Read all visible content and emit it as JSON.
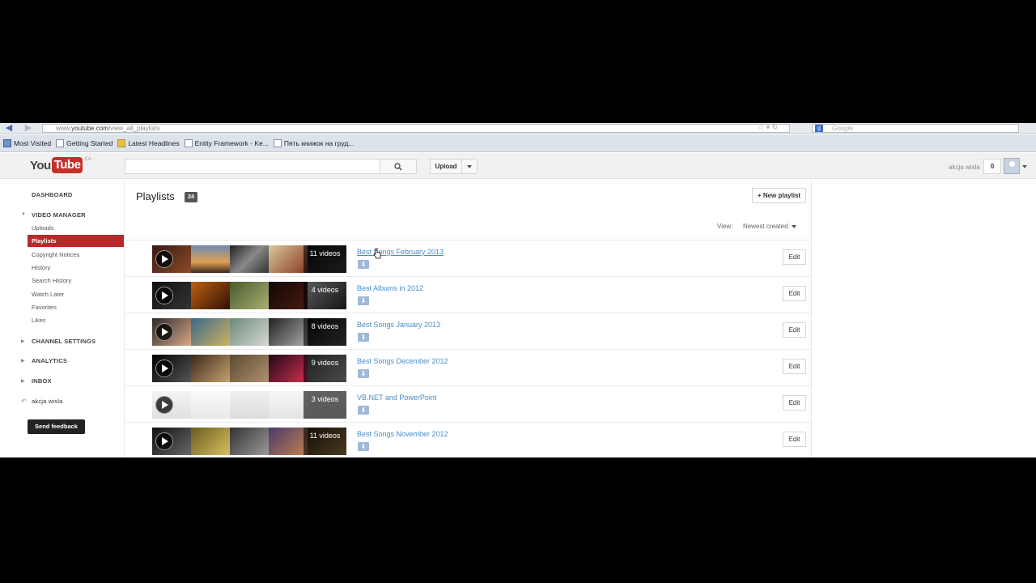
{
  "browser": {
    "url_prefix": "www.",
    "url_domain": "youtube.com",
    "url_path": "/view_all_playlists",
    "search_placeholder": "Google"
  },
  "bookmarks": [
    {
      "label": "Most Visited",
      "icon": "most-visited-icon"
    },
    {
      "label": "Getting Started",
      "icon": "page-icon"
    },
    {
      "label": "Latest Headlines",
      "icon": "rss-folder-icon"
    },
    {
      "label": "Entity Framework - Ke...",
      "icon": "page-icon"
    },
    {
      "label": "Пять книжок на груд...",
      "icon": "page-icon"
    }
  ],
  "header": {
    "logo_you": "You",
    "logo_tube": "Tube",
    "logo_region": "CA",
    "upload_label": "Upload",
    "username": "akcja wisla",
    "notification_count": "0"
  },
  "sidebar": {
    "dashboard": "DASHBOARD",
    "video_manager": "VIDEO MANAGER",
    "items": [
      {
        "label": "Uploads"
      },
      {
        "label": "Playlists"
      },
      {
        "label": "Copyright Notices"
      },
      {
        "label": "History"
      },
      {
        "label": "Search History"
      },
      {
        "label": "Watch Later"
      },
      {
        "label": "Favorites"
      },
      {
        "label": "Likes"
      }
    ],
    "channel_settings": "CHANNEL SETTINGS",
    "analytics": "ANALYTICS",
    "inbox": "INBOX",
    "user_link": "akcja wisla",
    "feedback_label": "Send feedback"
  },
  "main": {
    "title": "Playlists",
    "count": "24",
    "new_playlist_label": "+ New playlist",
    "view_label": "View:",
    "view_value": "Newest created",
    "edit_label": "Edit",
    "playlists": [
      {
        "title": "Best Songs February 2013",
        "videos": "11 videos"
      },
      {
        "title": "Best Albums in 2012",
        "videos": "4 videos"
      },
      {
        "title": "Best Songs January 2013",
        "videos": "8 videos"
      },
      {
        "title": "Best Songs December 2012",
        "videos": "9 videos"
      },
      {
        "title": "VB.NET and PowerPoint",
        "videos": "3 videos"
      },
      {
        "title": "Best Songs November 2012",
        "videos": "11 videos"
      }
    ]
  },
  "colors": {
    "brand_red": "#c4302b",
    "active_item": "#b8292a",
    "link_blue": "#4a8bc7"
  }
}
